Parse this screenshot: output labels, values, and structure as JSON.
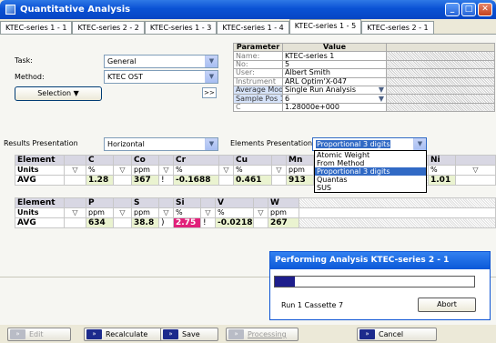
{
  "window": {
    "title": "Quantitative Analysis",
    "controls": [
      "_",
      "□",
      "✕"
    ]
  },
  "tabs": [
    "KTEC-series 1 - 1",
    "KTEC-series 2 - 2",
    "KTEC-series 1 - 3",
    "KTEC-series 1 - 4",
    "KTEC-series 1 - 5",
    "KTEC-series 2 - 1"
  ],
  "active_tab": 4,
  "form": {
    "task_label": "Task:",
    "task_value": "General",
    "method_label": "Method:",
    "method_value": "KTEC OST",
    "selection_button": "Selection",
    "expand_button": ">>"
  },
  "params": {
    "header_param": "Parameter",
    "header_value": "Value",
    "rows": [
      {
        "name": "Name:",
        "value": "KTEC-series 1"
      },
      {
        "name": "No:",
        "value": "5"
      },
      {
        "name": "User:",
        "value": "Albert Smith"
      },
      {
        "name": "Instrument",
        "value": "ARL Optim'X-047"
      },
      {
        "name": "Average Mode",
        "value": "Single Run Analysis"
      },
      {
        "name": "Sample Pos 1",
        "value": "6"
      },
      {
        "name": "C",
        "value": "1.28000e+000"
      }
    ]
  },
  "results": {
    "label": "Results Presentation",
    "value": "Horizontal",
    "elements_label": "Elements Presentation",
    "elements_value": "Proportional 3 digits"
  },
  "dropdown_options": [
    "Atomic Weight",
    "From Method",
    "Proportional 3 digits",
    "Quantas",
    "SUS"
  ],
  "dropdown_selected": 2,
  "table1": {
    "row_labels": [
      "Element",
      "Units",
      "AVG"
    ],
    "elements": [
      "C",
      "Co",
      "Cr",
      "Cu",
      "Mn",
      "Ni"
    ],
    "units": [
      "%",
      "ppm",
      "%",
      "%",
      "ppm",
      "%"
    ],
    "values": [
      "1.28",
      "367",
      "-0.1688",
      "0.461",
      "913",
      "1.01"
    ],
    "flags": [
      "",
      "!",
      "",
      "",
      "",
      ""
    ]
  },
  "table2": {
    "row_labels": [
      "Element",
      "Units",
      "AVG"
    ],
    "elements": [
      "P",
      "S",
      "Si",
      "V",
      "W"
    ],
    "units": [
      "ppm",
      "ppm",
      "%",
      "%",
      "ppm"
    ],
    "values": [
      "634",
      "38.8",
      "2.75",
      "-0.0218",
      "267"
    ],
    "flags": [
      "",
      ")",
      "!",
      "",
      ""
    ]
  },
  "progress_dialog": {
    "title": "Performing Analysis KTEC-series 2 - 1",
    "progress_fraction": 0.1,
    "status": "Run 1 Cassette 7",
    "abort_button": "Abort"
  },
  "bottom_buttons": [
    {
      "label": "Edit",
      "enabled": false
    },
    {
      "label": "Recalculate",
      "enabled": true
    },
    {
      "label": "Save",
      "enabled": true
    },
    {
      "label": "Processing",
      "enabled": false
    },
    {
      "label": "Cancel",
      "enabled": true
    }
  ]
}
